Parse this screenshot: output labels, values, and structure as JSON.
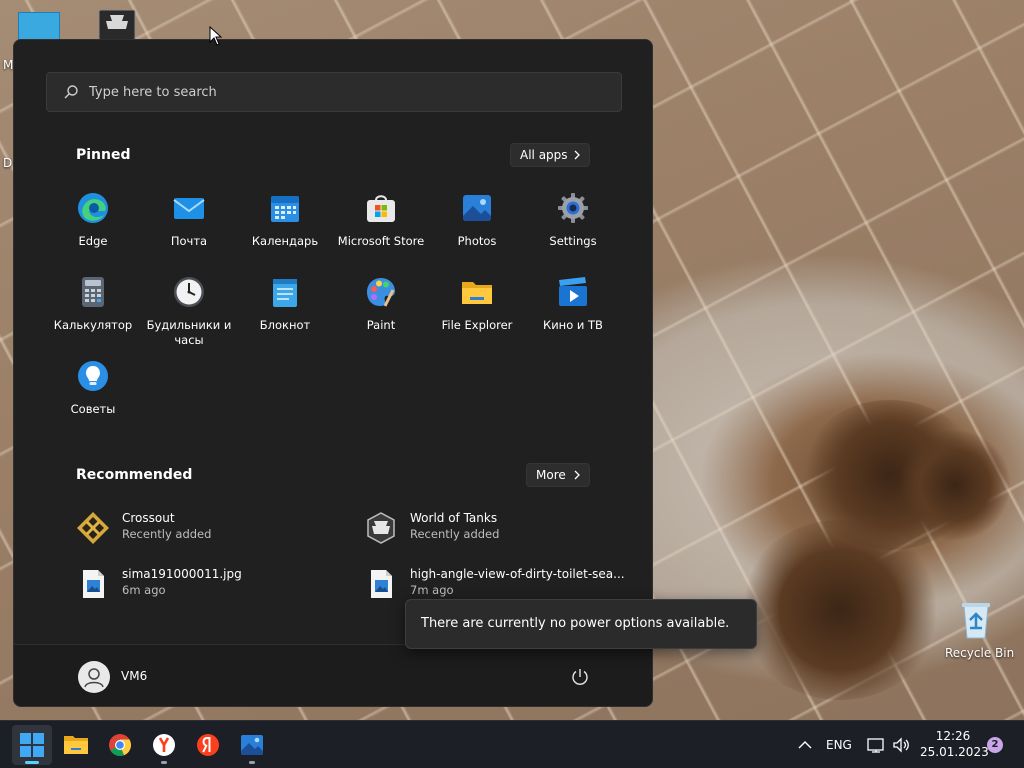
{
  "desktop": {
    "left_labels": [
      "M",
      "D"
    ],
    "recycle_bin_label": "Recycle Bin"
  },
  "start_menu": {
    "search": {
      "placeholder": "Type here to search"
    },
    "pinned": {
      "title": "Pinned",
      "all_apps_label": "All apps",
      "apps": [
        {
          "label": "Edge",
          "icon": "edge-icon"
        },
        {
          "label": "Почта",
          "icon": "mail-icon"
        },
        {
          "label": "Календарь",
          "icon": "calendar-icon"
        },
        {
          "label": "Microsoft Store",
          "icon": "store-icon"
        },
        {
          "label": "Photos",
          "icon": "photos-icon"
        },
        {
          "label": "Settings",
          "icon": "gear-icon"
        },
        {
          "label": "Калькулятор",
          "icon": "calculator-icon"
        },
        {
          "label": "Будильники и часы",
          "icon": "clock-icon"
        },
        {
          "label": "Блокнот",
          "icon": "notepad-icon"
        },
        {
          "label": "Paint",
          "icon": "palette-icon"
        },
        {
          "label": "File Explorer",
          "icon": "folder-icon"
        },
        {
          "label": "Кино и ТВ",
          "icon": "play-icon"
        },
        {
          "label": "Советы",
          "icon": "lightbulb-icon"
        }
      ]
    },
    "recommended": {
      "title": "Recommended",
      "more_label": "More",
      "items": [
        {
          "name": "Crossout",
          "sub": "Recently added",
          "icon": "crossout-icon"
        },
        {
          "name": "World of Tanks",
          "sub": "Recently added",
          "icon": "world-of-tanks-icon"
        },
        {
          "name": "sima191000011.jpg",
          "sub": "6m ago",
          "icon": "image-file-icon"
        },
        {
          "name": "high-angle-view-of-dirty-toilet-sea...",
          "sub": "7m ago",
          "icon": "image-file-icon"
        }
      ]
    },
    "user": {
      "name": "VM6"
    },
    "power_tooltip": "There are currently no power options available."
  },
  "taskbar": {
    "apps": [
      "windows-start-icon",
      "file-explorer-icon",
      "chrome-icon",
      "yandex-browser-icon",
      "yandex-icon",
      "photos-icon"
    ],
    "tray": {
      "language": "ENG",
      "time": "12:26",
      "date": "25.01.2023",
      "notification_count": "2"
    }
  },
  "colors": {
    "menu_bg": "#202020",
    "taskbar_bg": "#1c1f26",
    "accent": "#60cdff"
  }
}
